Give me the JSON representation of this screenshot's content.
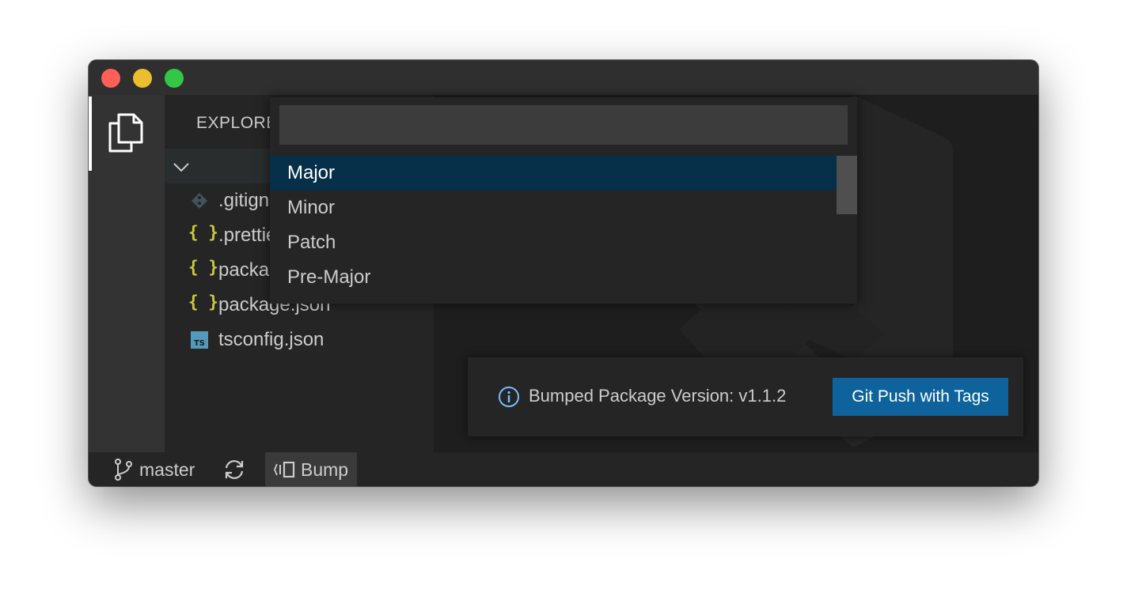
{
  "colors": {
    "accent_button": "#0e639c",
    "selection": "#062f4a",
    "info": "#75beff",
    "json_icon": "#cbcb41",
    "ts_icon": "#519aba"
  },
  "window": {
    "traffic_lights": [
      "close",
      "minimize",
      "maximize"
    ]
  },
  "activitybar": {
    "items": [
      {
        "icon": "files-icon",
        "active": true
      }
    ]
  },
  "sidebar": {
    "title": "EXPLORER",
    "files": [
      {
        "label": ".gitignore",
        "icon": "git-icon"
      },
      {
        "label": ".prettierrc",
        "icon": "json-braces-icon",
        "glyph": "{ }"
      },
      {
        "label": "package-lock.json",
        "icon": "json-braces-icon",
        "glyph": "{ }"
      },
      {
        "label": "package.json",
        "icon": "json-braces-icon",
        "glyph": "{ }"
      },
      {
        "label": "tsconfig.json",
        "icon": "typescript-icon"
      }
    ]
  },
  "quickpick": {
    "input_value": "",
    "input_placeholder": "",
    "items": [
      "Major",
      "Minor",
      "Patch",
      "Pre-Major"
    ],
    "selected_index": 0
  },
  "notification": {
    "message": "Bumped Package Version: v1.1.2",
    "button_label": "Git Push with Tags"
  },
  "statusbar": {
    "branch": "master",
    "bump_label": "Bump"
  }
}
